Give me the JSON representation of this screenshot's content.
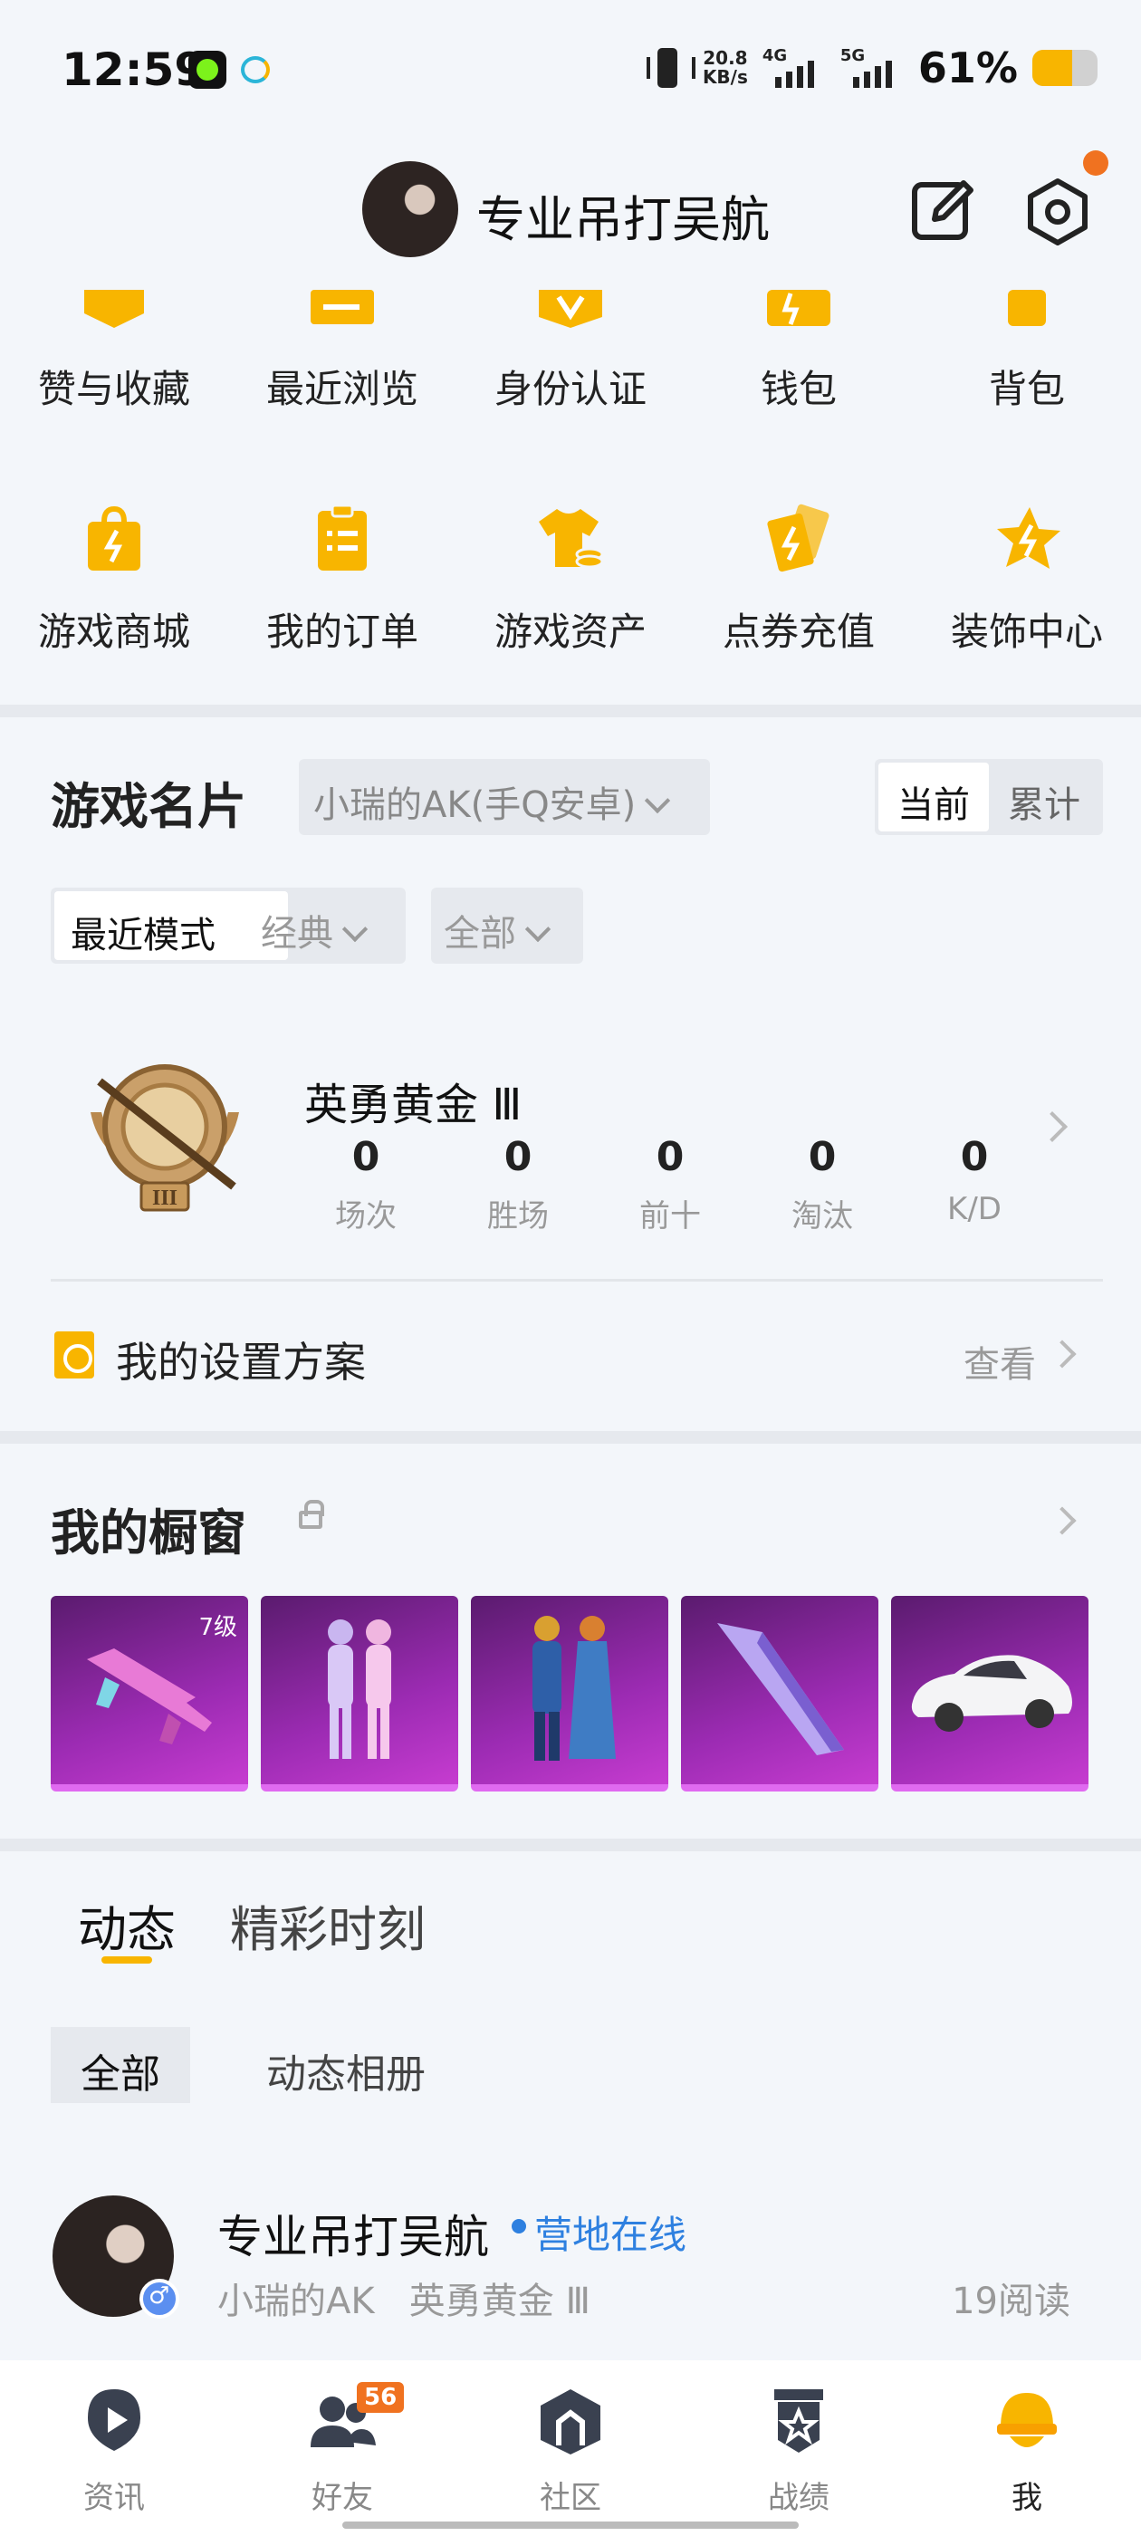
{
  "status_bar": {
    "time": "12:59",
    "net_speed_value": "20.8",
    "net_speed_unit": "KB/s",
    "network_1": "4G",
    "network_2": "5G",
    "battery_text": "61%",
    "battery_level": 0.61
  },
  "header": {
    "username": "专业吊打吴航",
    "edit_icon": "edit-icon",
    "settings_icon": "settings-icon",
    "has_notification": true
  },
  "menu_row_1": [
    {
      "label": "赞与收藏",
      "icon": "star-icon"
    },
    {
      "label": "最近浏览",
      "icon": "history-icon"
    },
    {
      "label": "身份认证",
      "icon": "badge-icon"
    },
    {
      "label": "钱包",
      "icon": "wallet-icon"
    },
    {
      "label": "背包",
      "icon": "bag-icon"
    }
  ],
  "menu_row_2": [
    {
      "label": "游戏商城",
      "icon": "shop-bag-icon"
    },
    {
      "label": "我的订单",
      "icon": "order-icon"
    },
    {
      "label": "游戏资产",
      "icon": "asset-shirt-icon"
    },
    {
      "label": "点券充值",
      "icon": "coupon-icon"
    },
    {
      "label": "装饰中心",
      "icon": "decoration-star-icon"
    }
  ],
  "game_card": {
    "title": "游戏名片",
    "account": "小瑞的AK(手Q安卓)",
    "segments": [
      "当前",
      "累计"
    ],
    "active_segment": 0,
    "mode_label": "最近模式",
    "mode_option": "经典",
    "scope_option": "全部",
    "rank_name": "英勇黄金 Ⅲ",
    "stats": [
      {
        "label": "场次",
        "value": "0"
      },
      {
        "label": "胜场",
        "value": "0"
      },
      {
        "label": "前十",
        "value": "0"
      },
      {
        "label": "淘汰",
        "value": "0"
      },
      {
        "label": "K/D",
        "value": "0"
      }
    ],
    "settings_plan_label": "我的设置方案",
    "settings_plan_action": "查看"
  },
  "showcase": {
    "title": "我的橱窗",
    "items": [
      {
        "name": "weapon-rifle",
        "level": "7级"
      },
      {
        "name": "outfit-pink-suits",
        "level": ""
      },
      {
        "name": "outfit-gold-blue",
        "level": ""
      },
      {
        "name": "weapon-glider",
        "level": ""
      },
      {
        "name": "vehicle-white-car",
        "level": ""
      }
    ]
  },
  "feed": {
    "tabs": [
      "动态",
      "精彩时刻"
    ],
    "active_tab": 0,
    "filters": [
      "全部",
      "动态相册"
    ],
    "post": {
      "author": "专业吊打吴航",
      "online_status": "营地在线",
      "meta": "小瑞的AK   英勇黄金 Ⅲ",
      "reads": "19阅读"
    }
  },
  "tab_bar": {
    "items": [
      {
        "label": "资讯",
        "icon": "news-play-icon"
      },
      {
        "label": "好友",
        "icon": "friends-icon",
        "badge": "56"
      },
      {
        "label": "社区",
        "icon": "community-icon"
      },
      {
        "label": "战绩",
        "icon": "record-icon"
      },
      {
        "label": "我",
        "icon": "me-helmet-icon"
      }
    ],
    "active_index": 4
  },
  "colors": {
    "accent": "#f8b500",
    "online": "#2e80e0",
    "notification": "#f07220",
    "showcase_tile": "#9c2bb3"
  }
}
